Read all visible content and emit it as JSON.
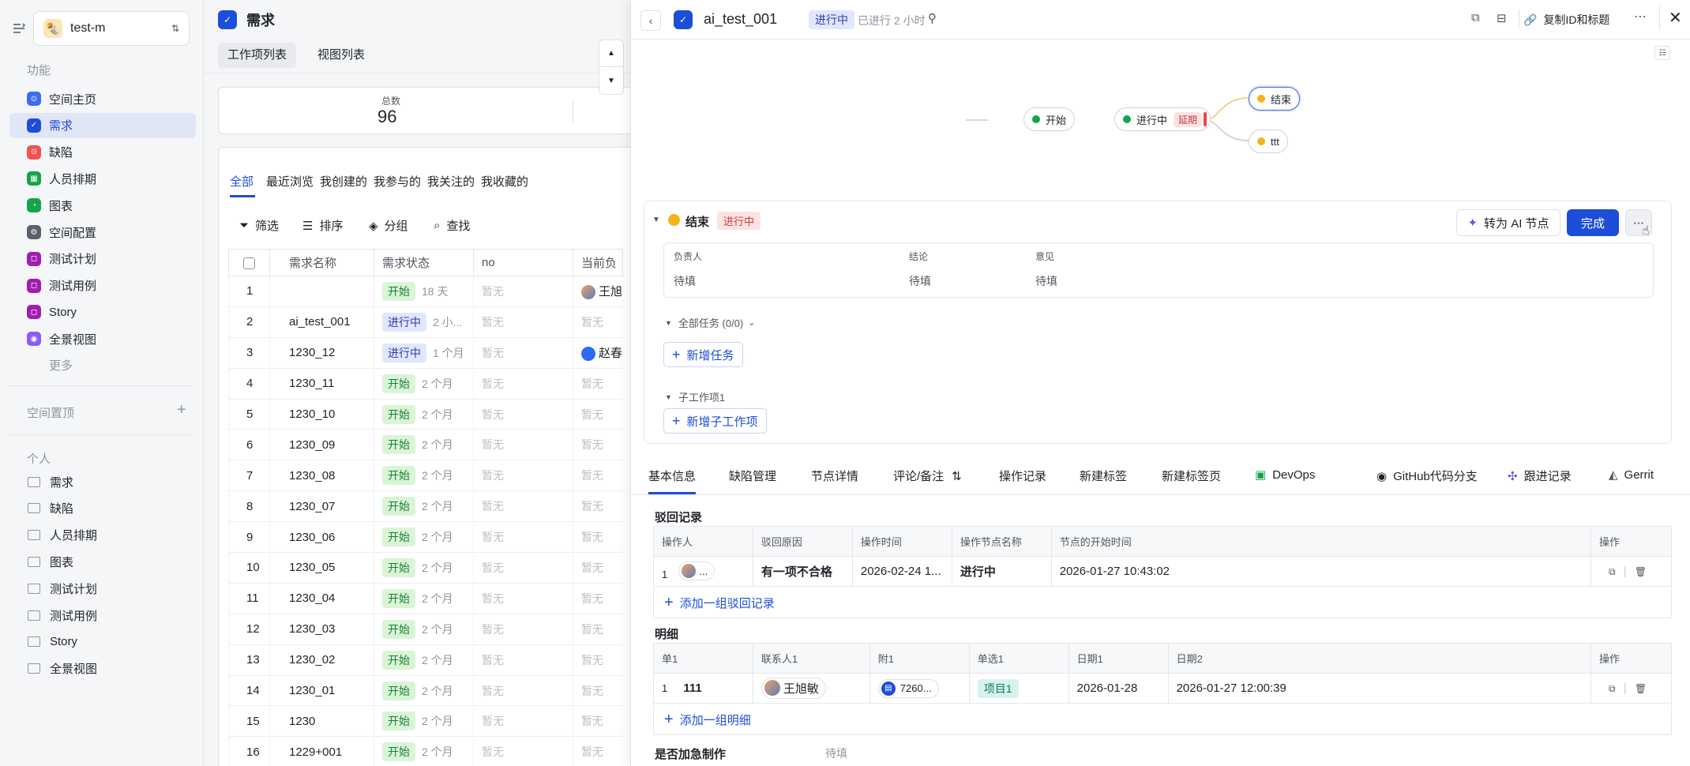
{
  "sidebar": {
    "space_name": "test-m",
    "section_function": "功能",
    "items": [
      {
        "label": "空间主页",
        "color": "#3b6cf6",
        "glyph": "⊙"
      },
      {
        "label": "需求",
        "color": "#1d4ed8",
        "glyph": "✓"
      },
      {
        "label": "缺陷",
        "color": "#f05252",
        "glyph": "⊙"
      },
      {
        "label": "人员排期",
        "color": "#16a34a",
        "glyph": "▦"
      },
      {
        "label": "图表",
        "color": "#16a34a",
        "glyph": "◔"
      },
      {
        "label": "空间配置",
        "color": "#5b616b",
        "glyph": "⚙"
      },
      {
        "label": "测试计划",
        "color": "#a21caf",
        "glyph": "◻"
      },
      {
        "label": "测试用例",
        "color": "#a21caf",
        "glyph": "◻"
      },
      {
        "label": "Story",
        "color": "#a21caf",
        "glyph": "◻"
      },
      {
        "label": "全景视图",
        "color": "#8b5cf6",
        "glyph": "◉"
      }
    ],
    "more": "更多",
    "section_pinned": "空间置顶",
    "section_personal": "个人",
    "personal_items": [
      "需求",
      "缺陷",
      "人员排期",
      "图表",
      "测试计划",
      "测试用例",
      "Story",
      "全景视图"
    ]
  },
  "middle": {
    "title": "需求",
    "view_tabs": [
      "工作项列表",
      "视图列表"
    ],
    "stat_label": "总数",
    "stat_value": "96",
    "list_tabs": [
      "全部",
      "最近浏览",
      "我创建的",
      "我参与的",
      "我关注的",
      "我收藏的"
    ],
    "tools": [
      "筛选",
      "排序",
      "分组",
      "查找"
    ],
    "columns": [
      "需求名称",
      "需求状态",
      "no",
      "当前负"
    ],
    "rows": [
      {
        "no": "1",
        "name": "",
        "status": "开始",
        "time": "18 天",
        "col_no": "暂无",
        "owner": "王旭",
        "owner_type": "photo"
      },
      {
        "no": "2",
        "name": "ai_test_001",
        "status": "进行中",
        "time": "2 小...",
        "col_no": "暂无",
        "owner": "暂无",
        "owner_type": "none"
      },
      {
        "no": "3",
        "name": "1230_12",
        "status": "进行中",
        "time": "1 个月",
        "col_no": "暂无",
        "owner": "赵春",
        "owner_type": "blue"
      },
      {
        "no": "4",
        "name": "1230_11",
        "status": "开始",
        "time": "2 个月",
        "col_no": "暂无",
        "owner": "暂无",
        "owner_type": "none"
      },
      {
        "no": "5",
        "name": "1230_10",
        "status": "开始",
        "time": "2 个月",
        "col_no": "暂无",
        "owner": "暂无",
        "owner_type": "none"
      },
      {
        "no": "6",
        "name": "1230_09",
        "status": "开始",
        "time": "2 个月",
        "col_no": "暂无",
        "owner": "暂无",
        "owner_type": "none"
      },
      {
        "no": "7",
        "name": "1230_08",
        "status": "开始",
        "time": "2 个月",
        "col_no": "暂无",
        "owner": "暂无",
        "owner_type": "none"
      },
      {
        "no": "8",
        "name": "1230_07",
        "status": "开始",
        "time": "2 个月",
        "col_no": "暂无",
        "owner": "暂无",
        "owner_type": "none"
      },
      {
        "no": "9",
        "name": "1230_06",
        "status": "开始",
        "time": "2 个月",
        "col_no": "暂无",
        "owner": "暂无",
        "owner_type": "none"
      },
      {
        "no": "10",
        "name": "1230_05",
        "status": "开始",
        "time": "2 个月",
        "col_no": "暂无",
        "owner": "暂无",
        "owner_type": "none"
      },
      {
        "no": "11",
        "name": "1230_04",
        "status": "开始",
        "time": "2 个月",
        "col_no": "暂无",
        "owner": "暂无",
        "owner_type": "none"
      },
      {
        "no": "12",
        "name": "1230_03",
        "status": "开始",
        "time": "2 个月",
        "col_no": "暂无",
        "owner": "暂无",
        "owner_type": "none"
      },
      {
        "no": "13",
        "name": "1230_02",
        "status": "开始",
        "time": "2 个月",
        "col_no": "暂无",
        "owner": "暂无",
        "owner_type": "none"
      },
      {
        "no": "14",
        "name": "1230_01",
        "status": "开始",
        "time": "2 个月",
        "col_no": "暂无",
        "owner": "暂无",
        "owner_type": "none"
      },
      {
        "no": "15",
        "name": "1230",
        "status": "开始",
        "time": "2 个月",
        "col_no": "暂无",
        "owner": "暂无",
        "owner_type": "none"
      },
      {
        "no": "16",
        "name": "1229+001",
        "status": "开始",
        "time": "2 个月",
        "col_no": "暂无",
        "owner": "暂无",
        "owner_type": "none"
      }
    ]
  },
  "detail": {
    "title": "ai_test_001",
    "status": "进行中",
    "elapsed": "已进行 2 小时",
    "copy_label": "复制ID和标题",
    "flow": {
      "start": "开始",
      "current": "进行中",
      "delay": "延期",
      "end": "结束",
      "other": "ttt"
    },
    "node_card": {
      "node_name": "结束",
      "node_status": "进行中",
      "ai_button": "转为 AI 节点",
      "done_button": "完成",
      "field_labels": [
        "负责人",
        "结论",
        "意见"
      ],
      "field_values": [
        "待填",
        "待填",
        "待填"
      ],
      "tasks_label": "全部任务 (0/0)",
      "add_task": "新增任务",
      "sub_label": "子工作项1",
      "add_sub": "新增子工作项"
    },
    "tabs": [
      "基本信息",
      "缺陷管理",
      "节点详情",
      "评论/备注",
      "操作记录",
      "新建标签",
      "新建标签页",
      "DevOps",
      "GitHub代码分支",
      "跟进记录",
      "Gerrit"
    ],
    "reject": {
      "title": "驳回记录",
      "columns": [
        "操作人",
        "驳回原因",
        "操作时间",
        "操作节点名称",
        "节点的开始时间",
        "操作"
      ],
      "row": {
        "index": "1",
        "operator": "...",
        "reason": "有一项不合格",
        "time": "2026-02-24 1...",
        "node": "进行中",
        "start": "2026-01-27 10:43:02"
      },
      "add_label": "添加一组驳回记录"
    },
    "detail_table": {
      "title": "明细",
      "columns": [
        "单1",
        "联系人1",
        "附1",
        "单选1",
        "日期1",
        "日期2",
        "操作"
      ],
      "row": {
        "index": "1",
        "single": "111",
        "contact": "王旭敏",
        "attach": "7260...",
        "radio": "项目1",
        "date1": "2026-01-28",
        "date2": "2026-01-27 12:00:39"
      },
      "add_label": "添加一组明细"
    },
    "urgent_label": "是否加急制作",
    "urgent_value": "待填"
  }
}
